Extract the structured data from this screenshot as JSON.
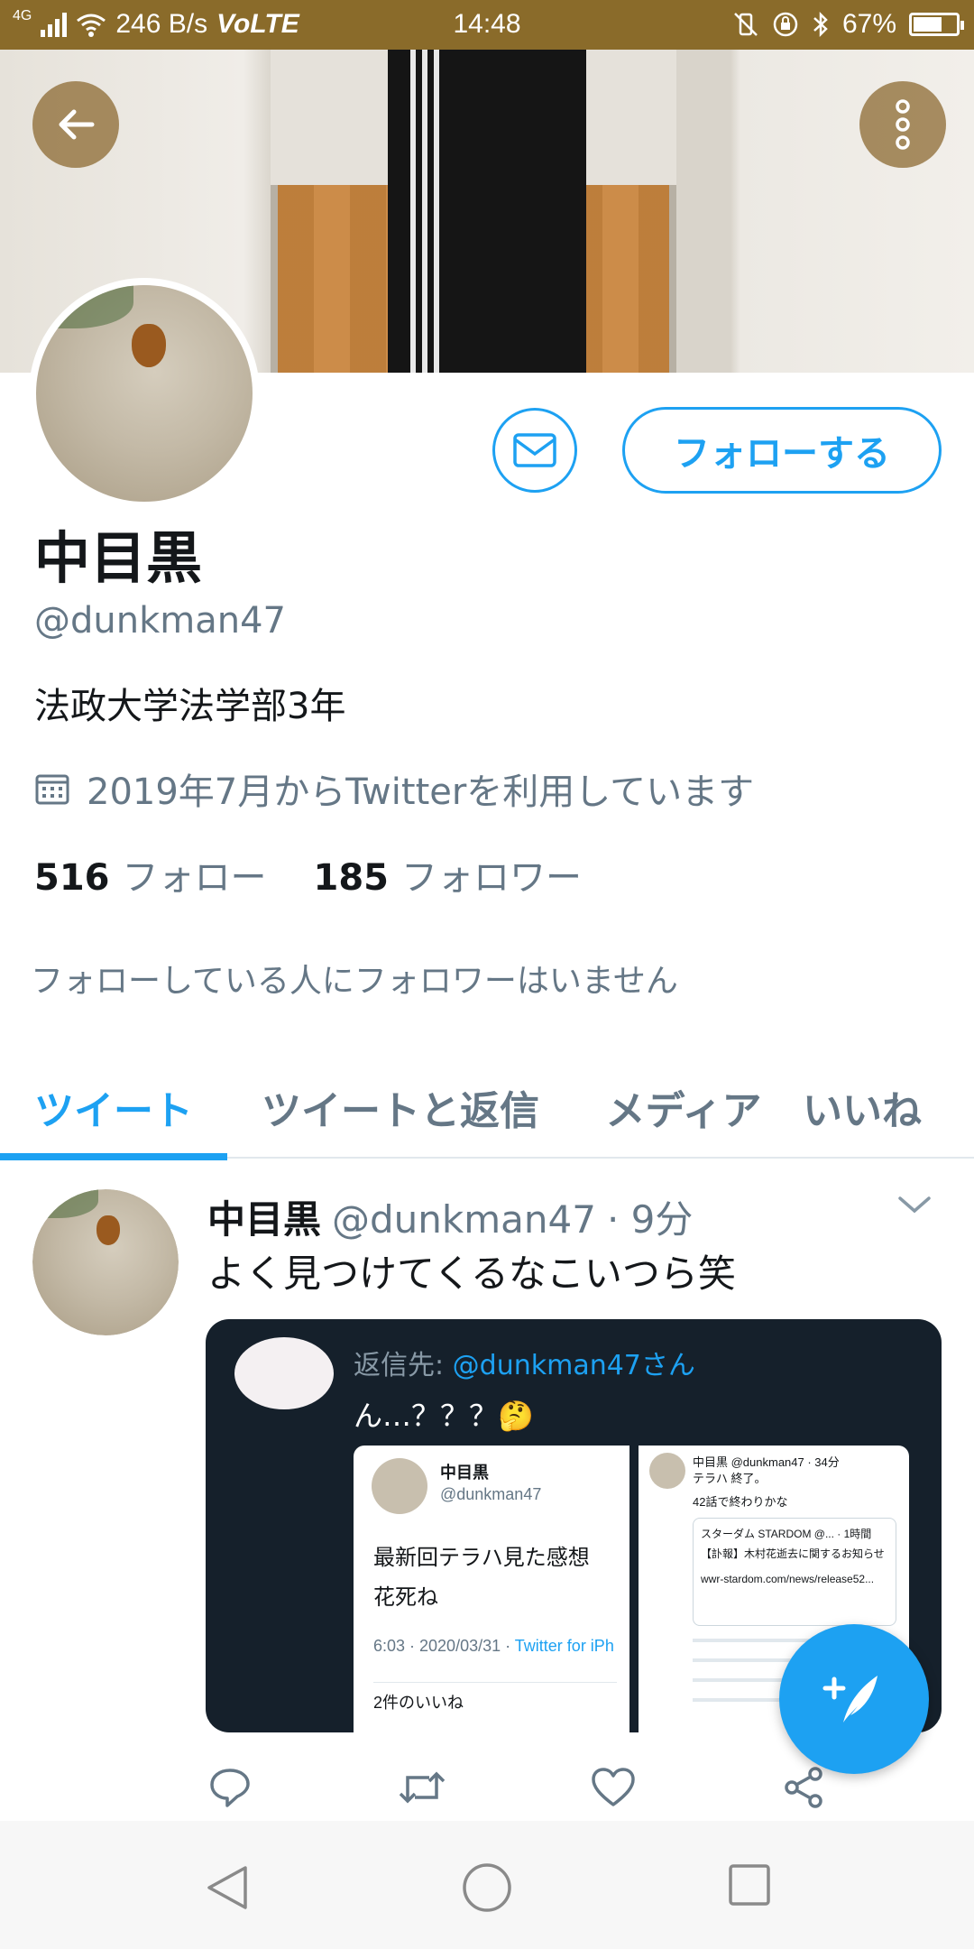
{
  "status_bar": {
    "network": "4G",
    "speed": "246 B/s",
    "volte": "VoLTE",
    "time": "14:48",
    "battery": "67%",
    "battery_level": 0.67
  },
  "profile": {
    "name": "中目黒",
    "handle": "@dunkman47",
    "bio": "法政大学法学部3年",
    "joined": "2019年7月からTwitterを利用しています",
    "following_count": "516",
    "following_label": "フォロー",
    "followers_count": "185",
    "followers_label": "フォロワー",
    "no_followers_you_know": "フォローしている人にフォロワーはいません",
    "follow_button": "フォローする"
  },
  "tabs": [
    {
      "label": "ツイート",
      "active": true
    },
    {
      "label": "ツイートと返信",
      "active": false
    },
    {
      "label": "メディア",
      "active": false
    },
    {
      "label": "いいね",
      "active": false
    }
  ],
  "tweet": {
    "name": "中目黒",
    "handle": "@dunkman47",
    "time": "· 9分",
    "text": "よく見つけてくるなこいつら笑",
    "media": {
      "reply_prefix": "返信先: ",
      "reply_handle": "@dunkman47さん",
      "reply_text": "ん…？？？🤔",
      "card1": {
        "name": "中目黒",
        "handle": "@dunkman47",
        "line1": "最新回テラハ見た感想",
        "line2": "花死ね",
        "meta_time": "6:03 · 2020/03/31 · ",
        "meta_source": "Twitter for iPh",
        "likes": "2件のいいね"
      },
      "card2": {
        "header": "中目黒 @dunkman47 · 34分",
        "line1": "テラハ 終了。",
        "line2": "42話で終わりかな",
        "box_name": "スターダム STARDOM @... · 1時間",
        "box_line1": "【訃報】木村花逝去に関するお知らせ",
        "box_line2": "wwr-stardom.com/news/release52..."
      }
    }
  },
  "icons": {
    "back": "arrow-left-icon",
    "more": "more-vertical-icon",
    "message": "envelope-icon",
    "calendar": "calendar-icon",
    "caret": "chevron-down-icon",
    "reply": "reply-icon",
    "retweet": "retweet-icon",
    "like": "heart-icon",
    "share": "share-icon",
    "compose": "compose-tweet-icon"
  },
  "colors": {
    "accent": "#1da1f2",
    "secondary_text": "#657786",
    "status_bar": "#8a6b2a"
  }
}
